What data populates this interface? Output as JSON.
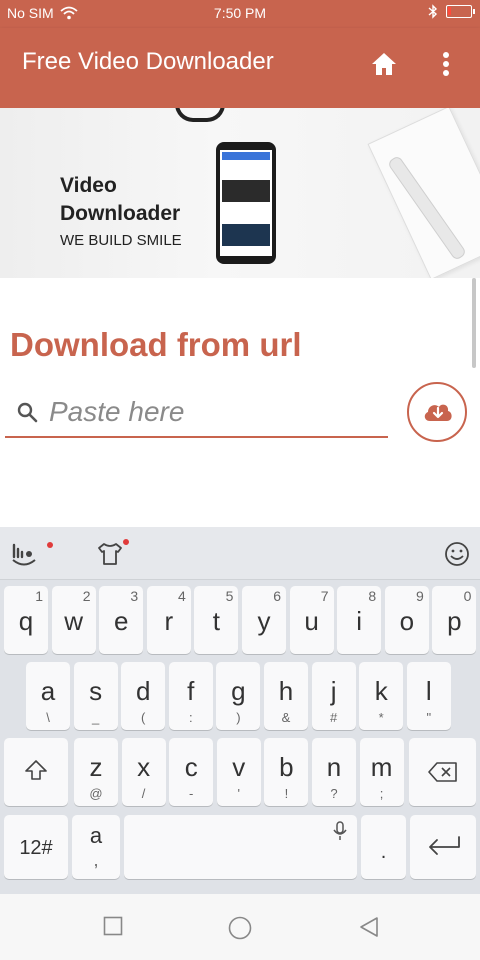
{
  "status_bar": {
    "carrier": "No SIM",
    "time": "7:50 PM"
  },
  "app_bar": {
    "title": "Free Video Downloader",
    "home_icon": "home-icon",
    "menu_icon": "more-vertical-icon"
  },
  "banner": {
    "line1": "Video",
    "line2": "Downloader",
    "tagline": "WE BUILD SMILE"
  },
  "main": {
    "section_title": "Download from url",
    "search_placeholder": "Paste here",
    "search_value": "",
    "download_icon": "cloud-download-icon"
  },
  "keyboard": {
    "row1": [
      {
        "key": "q",
        "hint": "1"
      },
      {
        "key": "w",
        "hint": "2"
      },
      {
        "key": "e",
        "hint": "3"
      },
      {
        "key": "r",
        "hint": "4"
      },
      {
        "key": "t",
        "hint": "5"
      },
      {
        "key": "y",
        "hint": "6"
      },
      {
        "key": "u",
        "hint": "7"
      },
      {
        "key": "i",
        "hint": "8"
      },
      {
        "key": "o",
        "hint": "9"
      },
      {
        "key": "p",
        "hint": "0"
      }
    ],
    "row2": [
      {
        "key": "a",
        "sub": "\\"
      },
      {
        "key": "s",
        "sub": "_"
      },
      {
        "key": "d",
        "sub": "("
      },
      {
        "key": "f",
        "sub": ":"
      },
      {
        "key": "g",
        "sub": ")"
      },
      {
        "key": "h",
        "sub": "&"
      },
      {
        "key": "j",
        "sub": "#"
      },
      {
        "key": "k",
        "sub": "*"
      },
      {
        "key": "l",
        "sub": "\""
      }
    ],
    "row3": [
      {
        "key": "z",
        "sub": "@"
      },
      {
        "key": "x",
        "sub": "/"
      },
      {
        "key": "c",
        "sub": "-"
      },
      {
        "key": "v",
        "sub": "'"
      },
      {
        "key": "b",
        "sub": "!"
      },
      {
        "key": "n",
        "sub": "?"
      },
      {
        "key": "m",
        "sub": ";"
      }
    ],
    "numbers_key": "12#",
    "lang_key_main": "a",
    "lang_key_sub": ",",
    "period_key": "."
  },
  "colors": {
    "accent": "#c8644e",
    "keyboard_bg": "#dfe2e7"
  }
}
